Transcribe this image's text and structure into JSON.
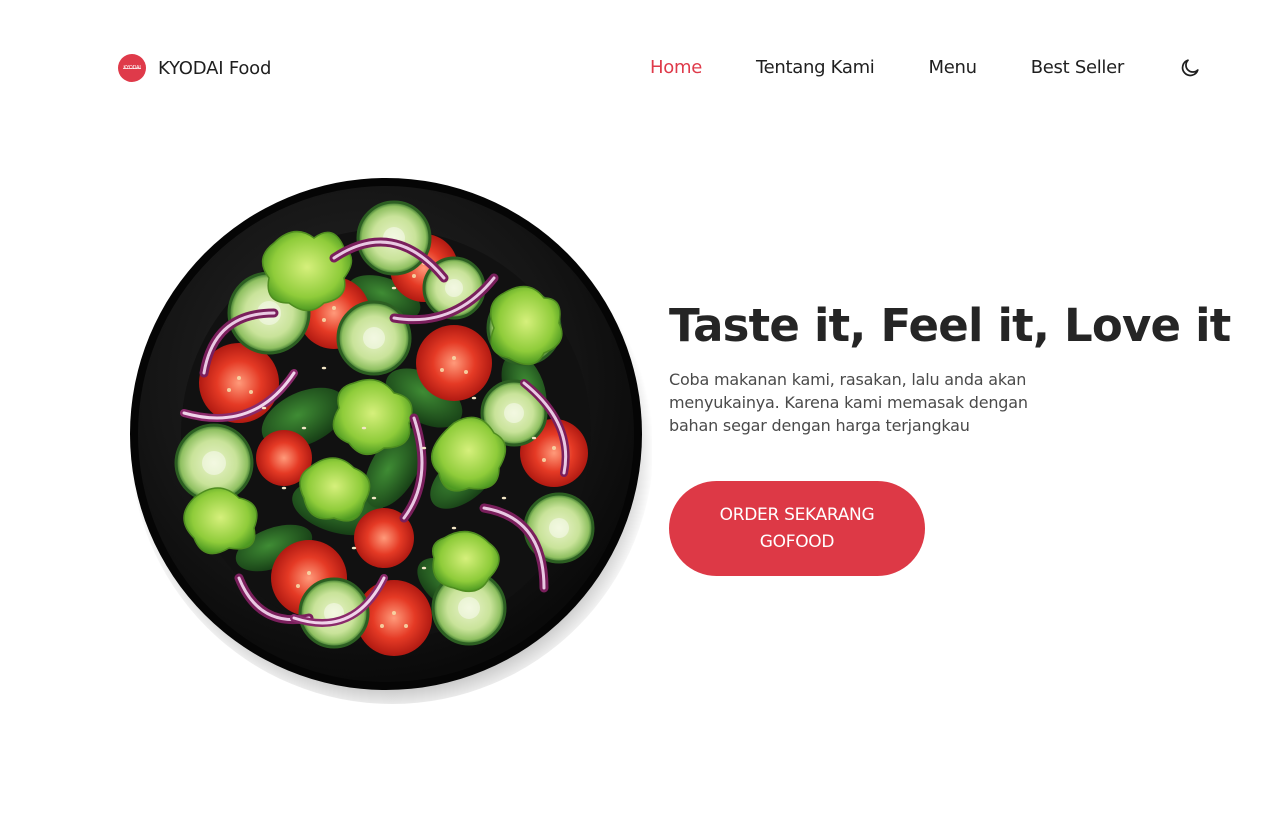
{
  "brand": {
    "name": "KYODAI Food",
    "logo_text": "KYODAI"
  },
  "nav": {
    "items": [
      {
        "label": "Home",
        "active": true
      },
      {
        "label": "Tentang Kami",
        "active": false
      },
      {
        "label": "Menu",
        "active": false
      },
      {
        "label": "Best Seller",
        "active": false
      }
    ],
    "theme_icon": "moon-icon"
  },
  "hero": {
    "title": "Taste it, Feel it, Love it",
    "description": "Coba makanan kami, rasakan, lalu anda akan menyukainya. Karena kami memasak dengan bahan segar dengan harga terjangkau",
    "cta_line1": "ORDER SEKARANG",
    "cta_line2": "GOFOOD",
    "image": "salad-bowl-image"
  },
  "colors": {
    "accent": "#dd3946",
    "text": "#252525",
    "background": "#ffffff"
  }
}
